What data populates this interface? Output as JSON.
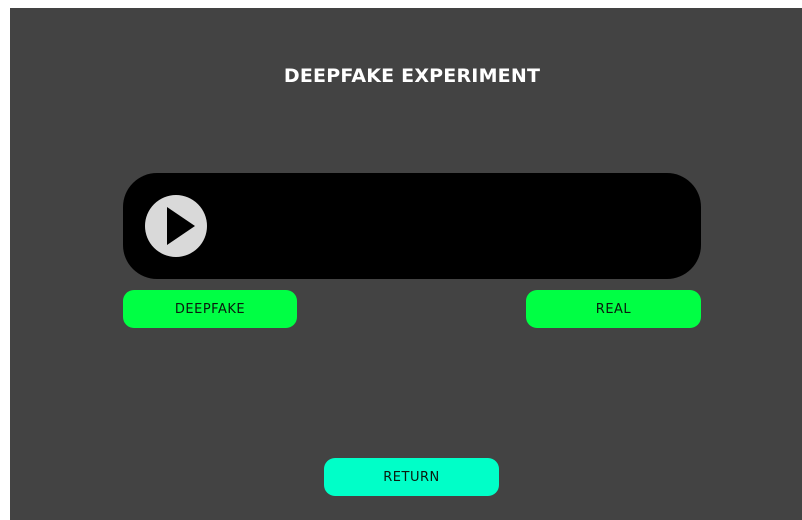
{
  "header": {
    "title": "DEEPFAKE EXPERIMENT"
  },
  "video_player": {
    "play_icon": "play-circle-icon"
  },
  "choices": {
    "deepfake_label": "DEEPFAKE",
    "real_label": "REAL"
  },
  "navigation": {
    "return_label": "RETURN"
  },
  "colors": {
    "background": "#434343",
    "player": "#000000",
    "choice_button": "#00FF44",
    "return_button": "#00FFC8",
    "play_icon_fill": "#D9D9D9",
    "title_text": "#FFFFFF"
  }
}
